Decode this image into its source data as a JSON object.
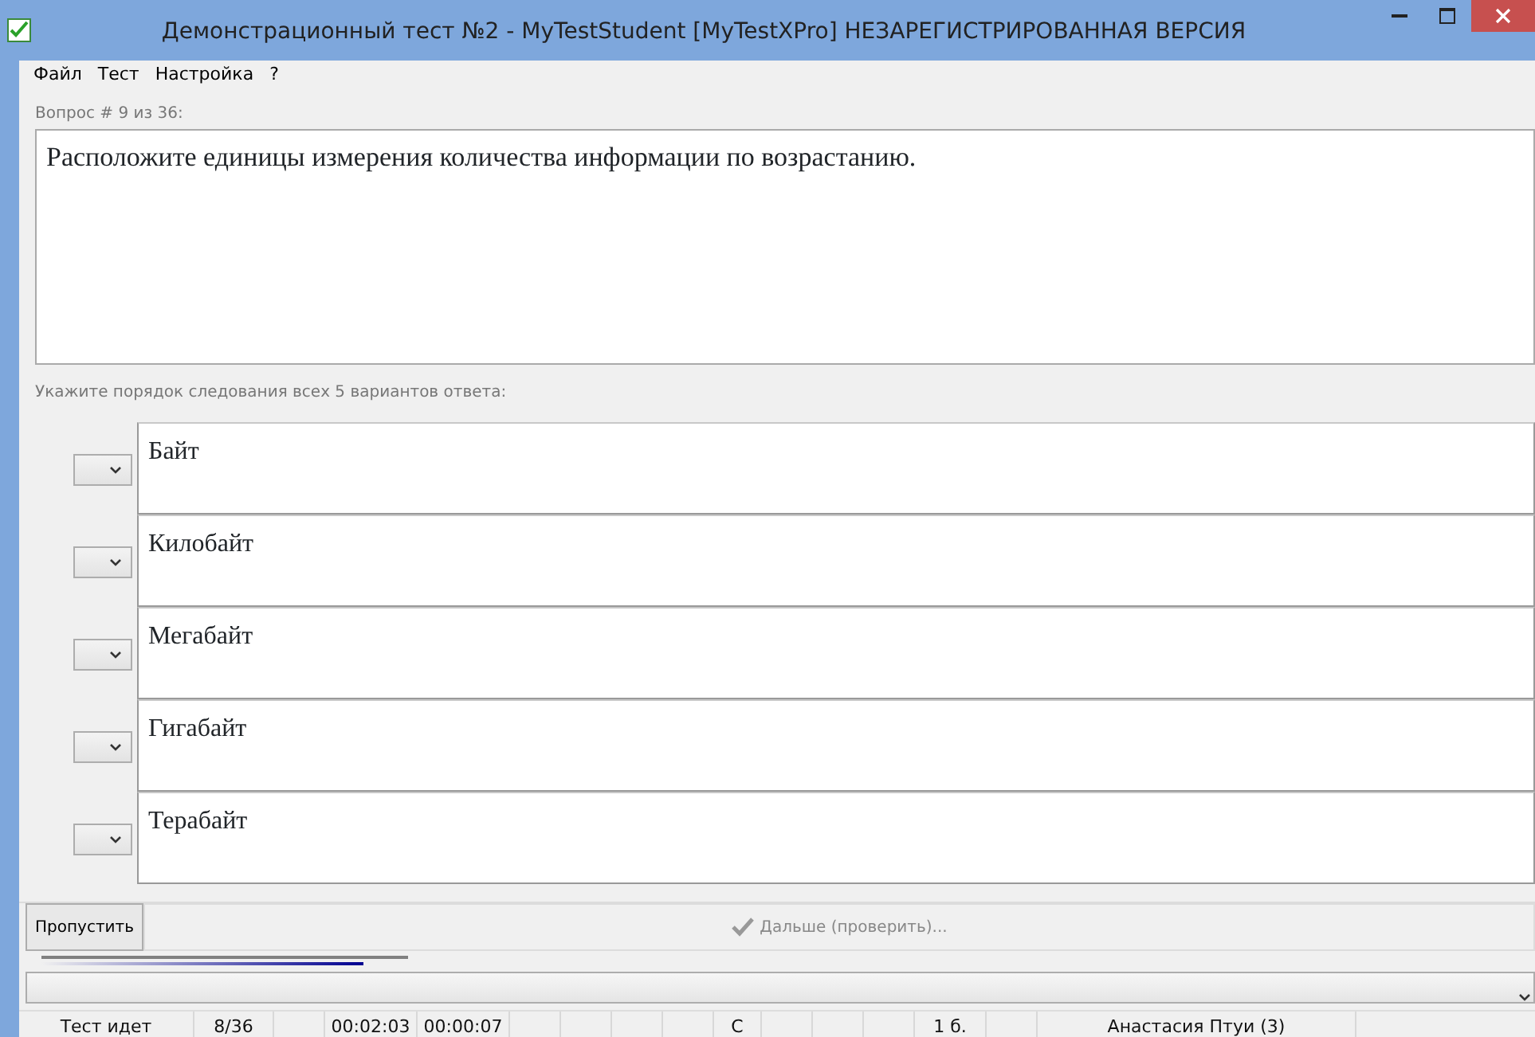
{
  "window": {
    "title": "Демонстрационный тест №2 - MyTestStudent [MyTestXPro] НЕЗАРЕГИСТРИРОВАННАЯ ВЕРСИЯ"
  },
  "menu": [
    "Файл",
    "Тест",
    "Настройка",
    "?"
  ],
  "question": {
    "counter": "Вопрос # 9 из 36:",
    "text": "Расположите единицы измерения количества информации по возрастанию."
  },
  "instruction": "Укажите порядок следования всех 5 вариантов ответа:",
  "answers": [
    {
      "text": "Байт"
    },
    {
      "text": "Килобайт"
    },
    {
      "text": "Мегабайт"
    },
    {
      "text": "Гигабайт"
    },
    {
      "text": "Терабайт"
    }
  ],
  "buttons": [
    {
      "label": "Пропустить",
      "disabled": false
    },
    {
      "label": "Дальше (проверить)...",
      "disabled": true
    }
  ],
  "progress": {
    "level": 0.88
  },
  "status_bar": [
    {
      "text": "Тест идет"
    },
    {
      "text": "8/36"
    },
    {
      "text": "00:02:03"
    },
    {
      "text": "00:00:07"
    },
    {
      "text": "С"
    },
    {
      "text": "1 б."
    },
    {
      "text": "Анастасия Птуи (3)"
    }
  ]
}
